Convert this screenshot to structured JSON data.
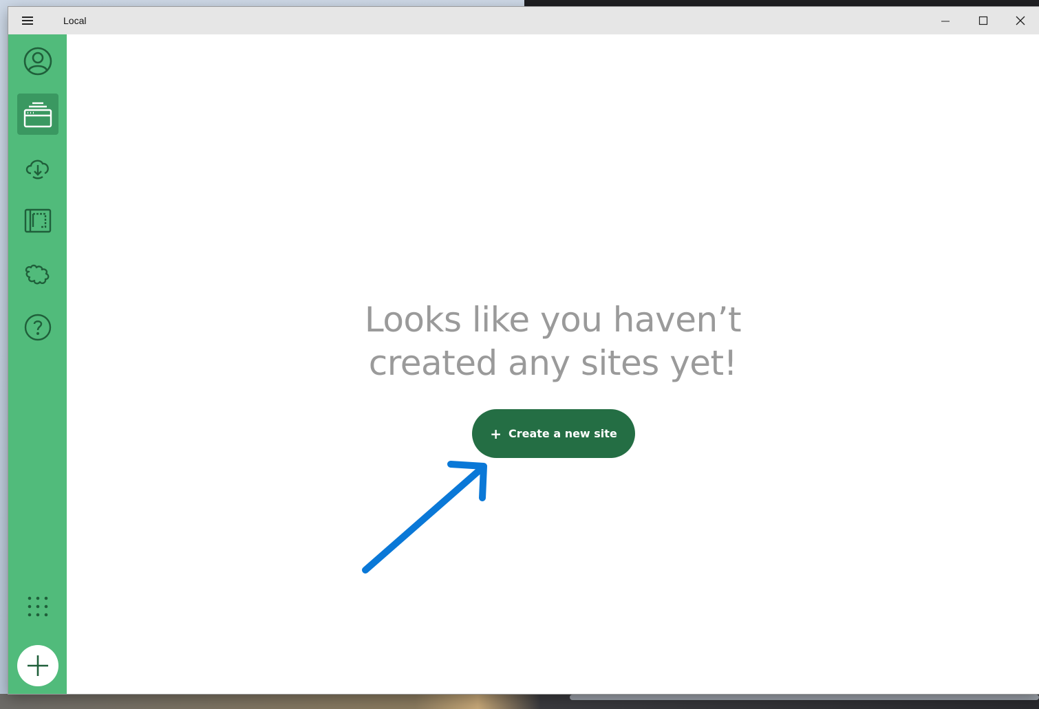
{
  "window": {
    "title": "Local",
    "controls": {
      "minimize": "minimize-icon",
      "maximize": "maximize-icon",
      "close": "close-icon"
    }
  },
  "sidebar": {
    "items": [
      {
        "name": "profile",
        "icon": "user-circle-icon",
        "active": false
      },
      {
        "name": "local-sites",
        "icon": "browser-stack-icon",
        "active": true
      },
      {
        "name": "connect",
        "icon": "cloud-sync-icon",
        "active": false
      },
      {
        "name": "blueprints",
        "icon": "blueprint-icon",
        "active": false
      },
      {
        "name": "add-ons",
        "icon": "puzzle-icon",
        "active": false
      },
      {
        "name": "help",
        "icon": "question-circle-icon",
        "active": false
      }
    ],
    "apps_icon": "grid-dots-icon",
    "add_icon": "plus-icon"
  },
  "main": {
    "empty_line1": "Looks like you haven’t",
    "empty_line2": "created any sites yet!",
    "cta_plus": "+",
    "cta_label": "Create a new site"
  },
  "colors": {
    "sidebar": "#51bb7b",
    "sidebar_active": "#3a9861",
    "sidebar_icon": "#1f5f3a",
    "cta": "#246e44",
    "empty_text": "#9a9a9a",
    "annotation_arrow": "#0a78d7"
  }
}
